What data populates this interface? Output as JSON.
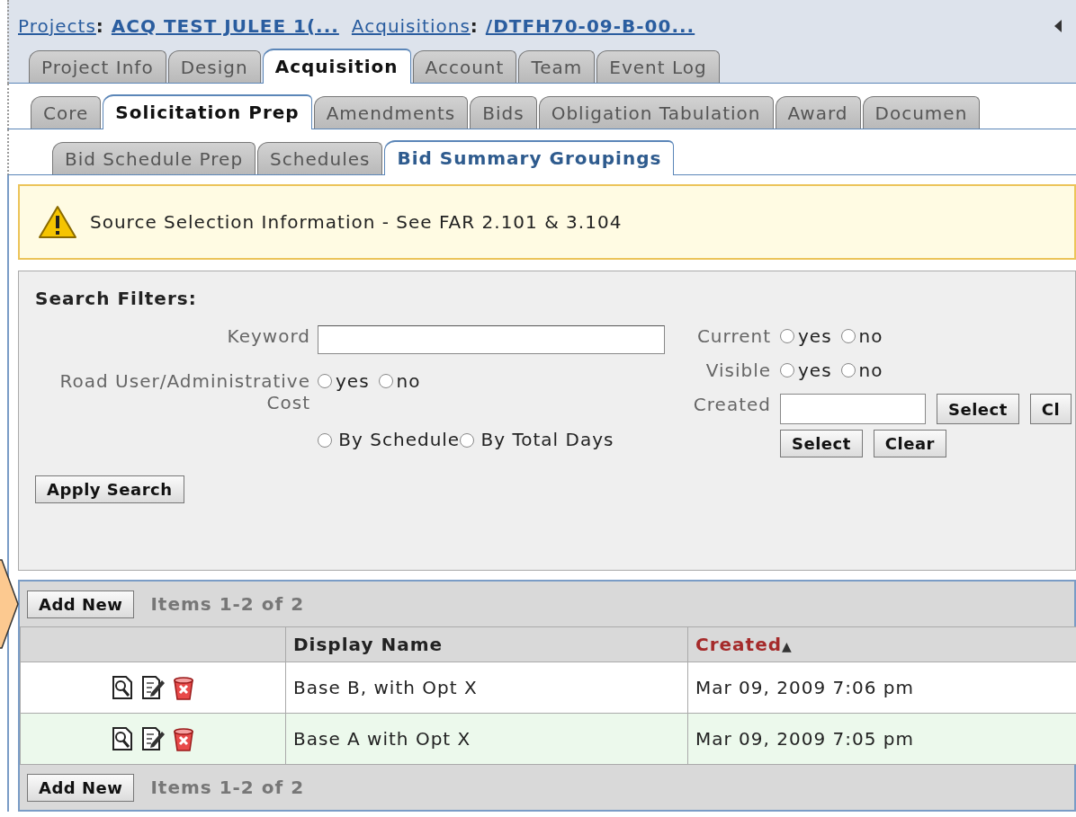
{
  "breadcrumb": [
    {
      "label": "Projects",
      "separator": ":",
      "value": "ACQ TEST JULEE 1(..."
    },
    {
      "label": "Acquisitions",
      "separator": ":",
      "value": "/DTFH70-09-B-00..."
    }
  ],
  "tab_rows": [
    [
      {
        "label": "Project Info",
        "selected": false
      },
      {
        "label": "Design",
        "selected": false
      },
      {
        "label": "Acquisition",
        "selected": true
      },
      {
        "label": "Account",
        "selected": false
      },
      {
        "label": "Team",
        "selected": false
      },
      {
        "label": "Event Log",
        "selected": false
      }
    ],
    [
      {
        "label": "Core",
        "selected": false
      },
      {
        "label": "Solicitation Prep",
        "selected": true
      },
      {
        "label": "Amendments",
        "selected": false
      },
      {
        "label": "Bids",
        "selected": false
      },
      {
        "label": "Obligation Tabulation",
        "selected": false
      },
      {
        "label": "Award",
        "selected": false
      },
      {
        "label": "Documen",
        "selected": false
      }
    ],
    [
      {
        "label": "Bid Schedule Prep",
        "selected": false
      },
      {
        "label": "Schedules",
        "selected": false
      },
      {
        "label": "Bid Summary Groupings",
        "selected": true
      }
    ]
  ],
  "alert": {
    "text": "Source Selection Information - See FAR 2.101 & 3.104"
  },
  "filters": {
    "title": "Search Filters:",
    "keyword": {
      "label": "Keyword"
    },
    "road_user": {
      "label": "Road User/Administrative Cost",
      "options": [
        {
          "label": "yes",
          "selected": false
        },
        {
          "label": "no",
          "selected": false
        }
      ]
    },
    "schedule_mode": {
      "options": [
        {
          "label": "By Schedule",
          "selected": false
        },
        {
          "label": "By Total Days",
          "selected": false
        }
      ]
    },
    "current": {
      "label": "Current",
      "options": [
        {
          "label": "yes",
          "selected": false
        },
        {
          "label": "no",
          "selected": false
        }
      ]
    },
    "visible": {
      "label": "Visible",
      "options": [
        {
          "label": "yes",
          "selected": false
        },
        {
          "label": "no",
          "selected": false
        }
      ]
    },
    "created": {
      "label": "Created",
      "buttons": [
        "Select",
        "Cl"
      ],
      "buttons_2": [
        "Select",
        "Clear"
      ]
    },
    "apply_button": "Apply Search"
  },
  "grid": {
    "top_toolbar": {
      "button": "Add New",
      "count": "Items 1-2 of 2"
    },
    "columns": [
      {
        "label": "Display Name",
        "sorted": false
      },
      {
        "label": "Created",
        "sorted": true,
        "sort_arrow": "▲"
      }
    ],
    "rows": [
      {
        "name": "Base B, with Opt X",
        "created": "Mar 09, 2009 7:06 pm"
      },
      {
        "name": "Base A with Opt X",
        "created": "Mar 09, 2009 7:05 pm"
      }
    ],
    "bottom_toolbar": {
      "button": "Add New",
      "count": "Items 1-2 of 2"
    }
  }
}
